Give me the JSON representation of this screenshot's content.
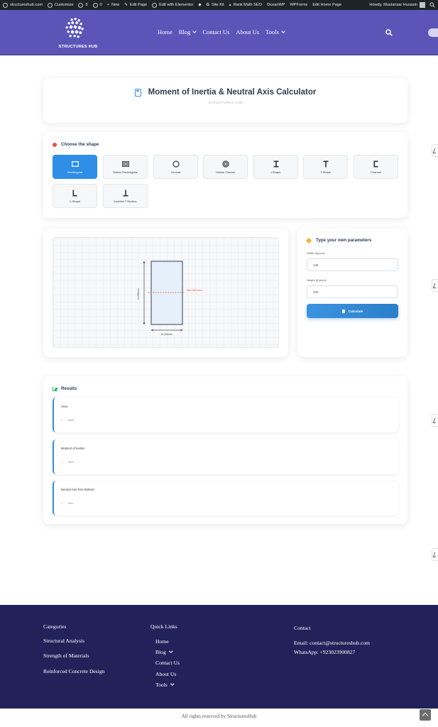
{
  "admin_bar": {
    "items": [
      {
        "label": "structureshub.com"
      },
      {
        "label": "Customize"
      },
      {
        "label": "6"
      },
      {
        "label": "0"
      },
      {
        "label": "New"
      },
      {
        "label": "Edit Page"
      },
      {
        "label": "Edit with Elementor"
      },
      {
        "label": ""
      },
      {
        "label": "Site Kit"
      },
      {
        "label": "Rank Math SEO"
      },
      {
        "label": "OceanWP"
      },
      {
        "label": "WPForms"
      },
      {
        "label": "Edit Home Page"
      }
    ],
    "howdy": "Howdy, Mustansar Hussain"
  },
  "header": {
    "logo_text": "STRUCTURES HUB",
    "nav": [
      {
        "label": "Home",
        "dropdown": false
      },
      {
        "label": "Blog",
        "dropdown": true
      },
      {
        "label": "Contact Us",
        "dropdown": false
      },
      {
        "label": "About Us",
        "dropdown": false
      },
      {
        "label": "Tools",
        "dropdown": true
      }
    ],
    "colors": {
      "header_bg": "#5b55b8",
      "admin_bg": "#1d2327"
    }
  },
  "title_card": {
    "title": "Moment of Inertia & Neutral Axis Calculator",
    "subtitle": "STRUCTURES HUB"
  },
  "shape_section": {
    "heading": "Choose the shape",
    "shapes": [
      {
        "label": "Rectangular",
        "icon": "rectangle-icon",
        "active": true
      },
      {
        "label": "Hollow Rectangular",
        "icon": "hollow-rectangle-icon",
        "active": false
      },
      {
        "label": "Circular",
        "icon": "circle-icon",
        "active": false
      },
      {
        "label": "Hollow Circular",
        "icon": "hollow-circle-icon",
        "active": false
      },
      {
        "label": "I-Shape",
        "icon": "i-shape-icon",
        "active": false
      },
      {
        "label": "T-Shape",
        "icon": "t-shape-icon",
        "active": false
      },
      {
        "label": "Channel",
        "icon": "channel-icon",
        "active": false
      },
      {
        "label": "L-Shape",
        "icon": "l-shape-icon",
        "active": false
      },
      {
        "label": "Inverted T Section",
        "icon": "inverted-t-icon",
        "active": false
      }
    ],
    "active_color": "#2f8ee6"
  },
  "drawing": {
    "height_label": "h=200mm",
    "width_label": "b=100mm",
    "neutral_axis_label": "NA=100.0mm",
    "na_color": "#e74c3c"
  },
  "params": {
    "heading": "Type your own parameters",
    "fields": [
      {
        "label": "Width (b)(mm):",
        "value": "100"
      },
      {
        "label": "Height (h)(mm):",
        "value": "200"
      }
    ],
    "button": "Calculate"
  },
  "results": {
    "heading": "Results",
    "items": [
      {
        "label": "Area:",
        "value": "-",
        "unit": "mm²"
      },
      {
        "label": "Moment of Inertia:",
        "value": "-",
        "unit": "mm⁴"
      },
      {
        "label": "Neutral Axis from Bottom:",
        "value": "-",
        "unit": "mm"
      }
    ]
  },
  "footer": {
    "categories_title": "Categories",
    "categories": [
      "Structural Analysis",
      "Strength of Materials",
      "Reinforced Concrete Design"
    ],
    "quick_links_title": "Quick Links",
    "quick_links": [
      {
        "label": "Home",
        "dropdown": false
      },
      {
        "label": "Blog",
        "dropdown": true
      },
      {
        "label": "Contact Us",
        "dropdown": false
      },
      {
        "label": "About Us",
        "dropdown": false
      },
      {
        "label": "Tools",
        "dropdown": true
      }
    ],
    "contact_title": "Contact",
    "email": "Email: contact@structureshub.com",
    "whatsapp": "WhatsApp: +923023900827",
    "copyright": "All rights reserved by StructuresHub",
    "bg_color": "#232159"
  }
}
